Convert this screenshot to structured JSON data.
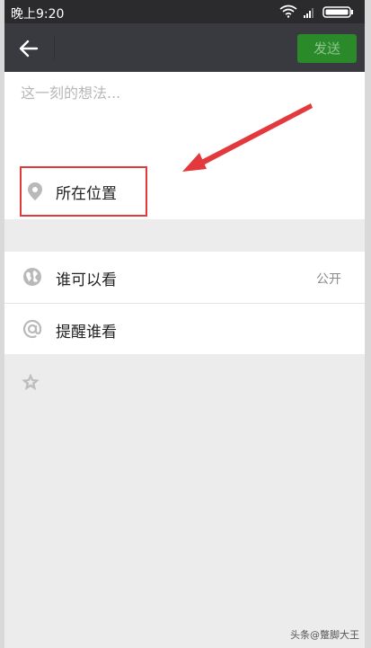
{
  "status_bar": {
    "time": "晚上9:20"
  },
  "title_bar": {
    "send_label": "发送"
  },
  "compose": {
    "placeholder": "这一刻的想法..."
  },
  "location": {
    "label": "所在位置"
  },
  "settings": {
    "rows": [
      {
        "label": "谁可以看",
        "value": "公开",
        "icon": "globe-icon"
      },
      {
        "label": "提醒谁看",
        "icon": "at-icon"
      }
    ]
  },
  "extra": {
    "icon": "star-icon"
  },
  "watermark": {
    "text": "头条@蹩脚大王"
  },
  "colors": {
    "title_bar": "#393a3f",
    "send_button": "#2a8a2a",
    "highlight": "#e4393c"
  }
}
